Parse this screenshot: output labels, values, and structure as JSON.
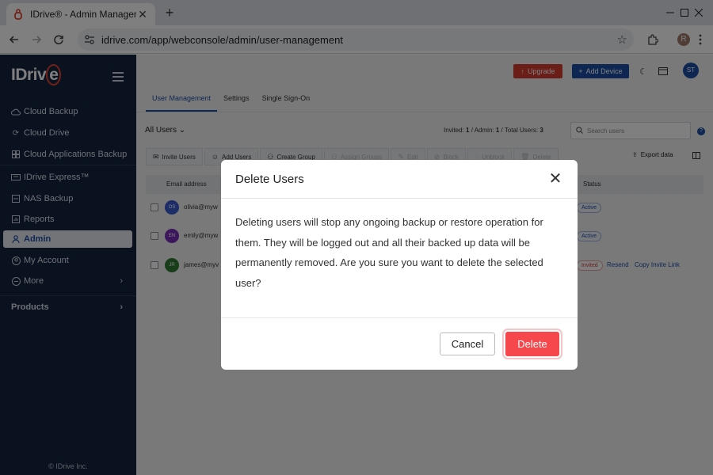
{
  "browser": {
    "tab_title": "IDrive® - Admin Management",
    "tab_close": "✕",
    "new_tab": "+",
    "url": "idrive.com/app/webconsole/admin/user-management",
    "profile_initial": "R"
  },
  "sidebar": {
    "logo_main": "IDriv",
    "logo_e": "e",
    "items": [
      {
        "label": "Cloud Backup",
        "icon": "cloud-icon"
      },
      {
        "label": "Cloud Drive",
        "icon": "sync-icon"
      },
      {
        "label": "Cloud Applications Backup",
        "icon": "apps-icon"
      },
      {
        "label": "IDrive Express™",
        "icon": "express-icon"
      },
      {
        "label": "NAS Backup",
        "icon": "nas-icon"
      },
      {
        "label": "Reports",
        "icon": "reports-icon"
      },
      {
        "label": "Admin",
        "icon": "admin-icon"
      },
      {
        "label": "My Account",
        "icon": "account-icon"
      },
      {
        "label": "More",
        "icon": "more-icon"
      }
    ],
    "products_label": "Products",
    "copyright": "© IDrive Inc."
  },
  "header": {
    "upgrade_label": "Upgrade",
    "add_device_label": "Add Device",
    "user_initials": "ST"
  },
  "page_tabs": [
    "User Management",
    "Settings",
    "Single Sign-On"
  ],
  "filter": {
    "all_users_label": "All Users",
    "invited_label": "Invited:",
    "invited_value": "1",
    "admin_label": "/ Admin:",
    "admin_value": "1",
    "total_label": "/ Total Users:",
    "total_value": "3",
    "search_placeholder": "Search users"
  },
  "actions": {
    "invite": "Invite Users",
    "add": "Add Users",
    "create_group": "Create Group",
    "assign_groups": "Assign Groups",
    "edit": "Edit",
    "block": "Block",
    "unblock": "Unblock",
    "delete": "Delete",
    "export": "Export data"
  },
  "table": {
    "col_email": "Email address",
    "col_status": "Status",
    "rows": [
      {
        "initials": "OS",
        "email": "olivia@myw",
        "status": "Active",
        "avatar_color": "#3a5bd0"
      },
      {
        "initials": "EN",
        "email": "emily@myw",
        "status": "Active",
        "avatar_color": "#7b2fb8"
      },
      {
        "initials": "JR",
        "email": "james@myv",
        "status": "Invited",
        "avatar_color": "#2e7d32",
        "resend": "Resend",
        "copy_link": "Copy Invite Link"
      }
    ]
  },
  "modal": {
    "title": "Delete Users",
    "close": "✕",
    "body": "Deleting users will stop any ongoing backup or restore operation for them. They will be logged out and all their backed up data will be permanently removed. Are you sure you want to delete the selected user?",
    "cancel_label": "Cancel",
    "delete_label": "Delete"
  },
  "colors": {
    "sidebar_bg": "#14253f",
    "accent": "#1c4fa5",
    "danger": "#f5474c"
  }
}
